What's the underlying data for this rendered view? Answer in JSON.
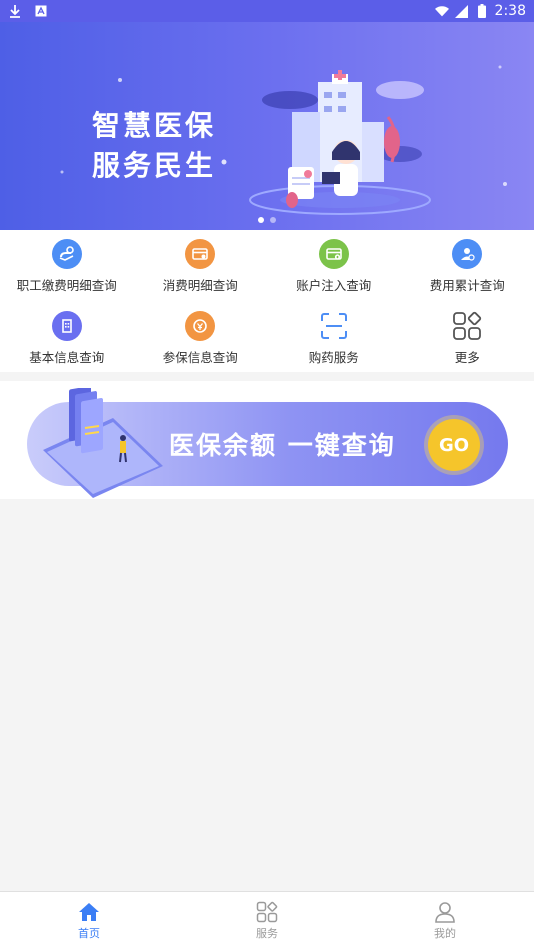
{
  "status_bar": {
    "time": "2:38",
    "left_icons": [
      "download-icon",
      "notification-a-icon"
    ],
    "right_icons": [
      "wifi-icon",
      "signal-icon",
      "battery-icon"
    ]
  },
  "banner": {
    "line1": "智慧医保",
    "line2": "服务民生",
    "carousel_count": 2,
    "active_index": 0
  },
  "grid": {
    "items": [
      {
        "label": "职工缴费明细查询",
        "icon": "payment-detail-icon",
        "color": "#4d8ef5"
      },
      {
        "label": "消费明细查询",
        "icon": "consumption-detail-icon",
        "color": "#f29542"
      },
      {
        "label": "账户注入查询",
        "icon": "account-inject-icon",
        "color": "#7cc34a"
      },
      {
        "label": "费用累计查询",
        "icon": "cost-accumulate-icon",
        "color": "#4d8ef5"
      },
      {
        "label": "基本信息查询",
        "icon": "basic-info-icon",
        "color": "#6a6ff0"
      },
      {
        "label": "参保信息查询",
        "icon": "insurance-info-icon",
        "color": "#f29542"
      },
      {
        "label": "购药服务",
        "icon": "scan-icon",
        "color": "#4d8ef5"
      },
      {
        "label": "更多",
        "icon": "more-grid-icon",
        "color": "#555555"
      }
    ]
  },
  "promo": {
    "text": "医保余额  一键查询",
    "go": "GO"
  },
  "bottom_nav": {
    "items": [
      {
        "label": "首页",
        "icon": "home-icon",
        "active": true
      },
      {
        "label": "服务",
        "icon": "service-grid-icon",
        "active": false
      },
      {
        "label": "我的",
        "icon": "person-icon",
        "active": false
      }
    ]
  }
}
